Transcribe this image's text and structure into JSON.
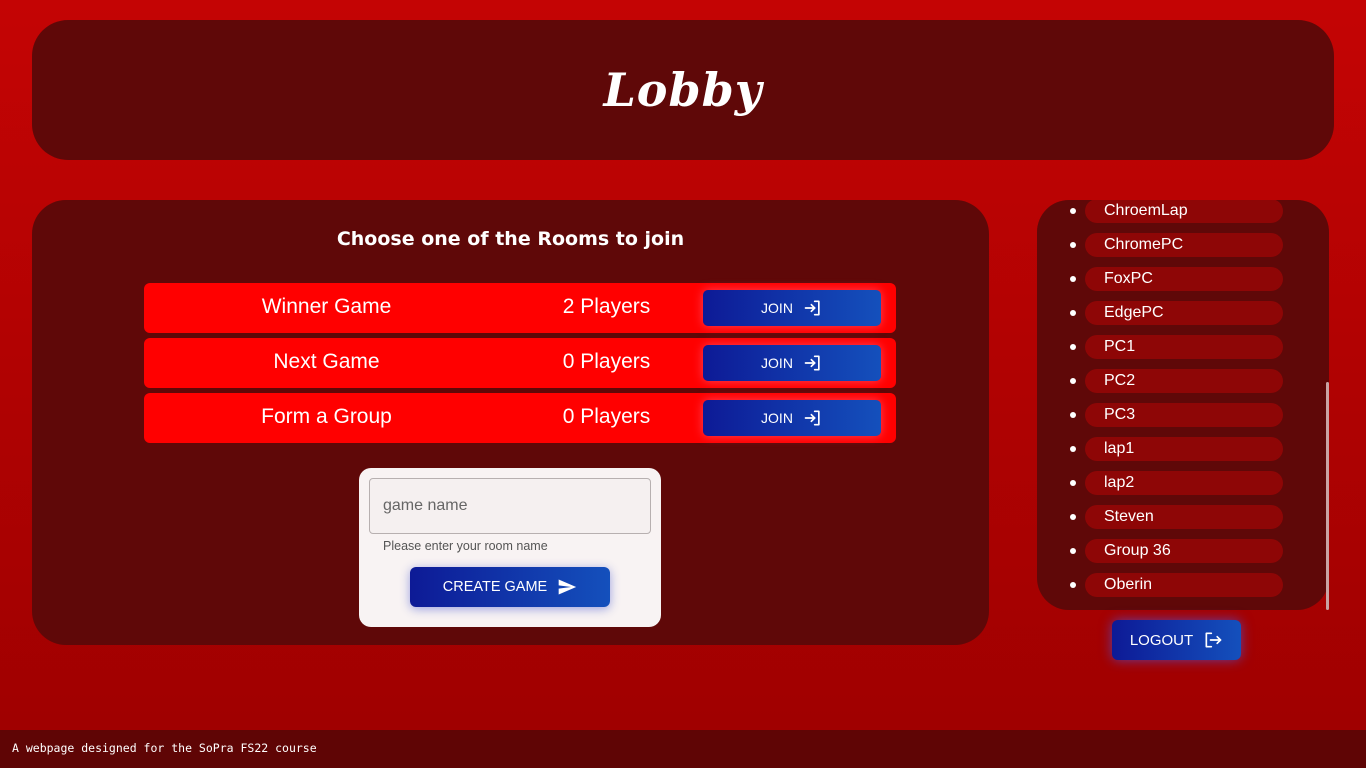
{
  "header": {
    "title": "Lobby"
  },
  "rooms": {
    "heading": "Choose one of the Rooms to join",
    "list": [
      {
        "name": "Winner Game",
        "players": "2 Players",
        "join_label": "JOIN"
      },
      {
        "name": "Next Game",
        "players": "0 Players",
        "join_label": "JOIN"
      },
      {
        "name": "Form a Group",
        "players": "0 Players",
        "join_label": "JOIN"
      }
    ]
  },
  "create": {
    "input_value": "",
    "input_placeholder": "game name",
    "helper_text": "Please enter your room name",
    "button_label": "CREATE GAME"
  },
  "users": {
    "list": [
      "ChroemLap",
      "ChromePC",
      "FoxPC",
      "EdgePC",
      "PC1",
      "PC2",
      "PC3",
      "lap1",
      "lap2",
      "Steven",
      "Group 36",
      "Oberin"
    ]
  },
  "logout": {
    "label": "LOGOUT"
  },
  "footer": {
    "text": "A webpage designed for the SoPra FS22 course"
  },
  "colors": {
    "background": "#c40404",
    "panel": "#5f0808",
    "room_row": "#ff0000",
    "button_gradient_start": "#0d1a96",
    "button_gradient_end": "#1450bc",
    "user_pill": "#8e0606"
  },
  "icons": {
    "join": "login-arrow-icon",
    "create": "send-icon",
    "logout": "logout-icon"
  }
}
